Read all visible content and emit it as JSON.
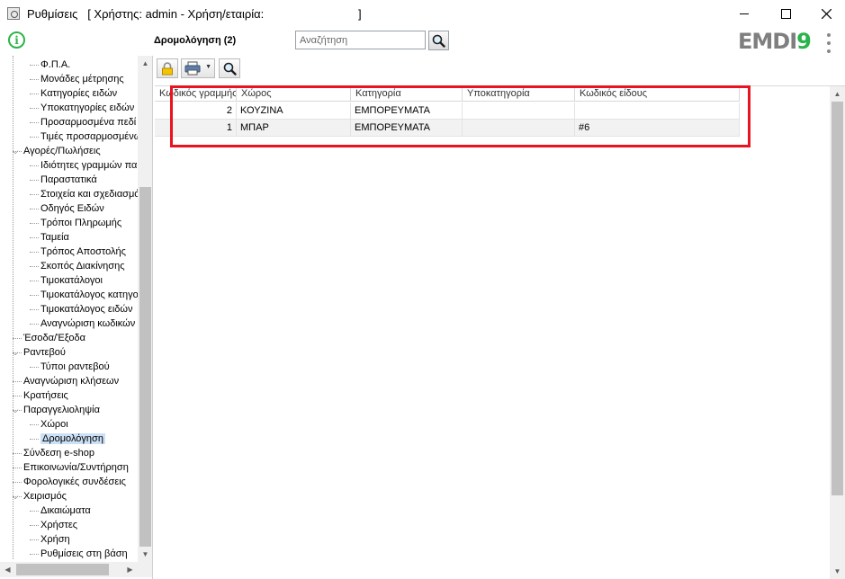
{
  "window": {
    "title": "Ρυθμίσεις   [ Χρήστης: admin - Χρήση/εταιρία:                             ]",
    "controls": {
      "minimize": "minimize",
      "maximize": "maximize",
      "close": "close"
    }
  },
  "header": {
    "page_title": "Δρομολόγηση (2)",
    "search_placeholder": "Αναζήτηση",
    "logo": {
      "part1": "EMDI",
      "part2": "9"
    }
  },
  "colors": {
    "brand_green": "#2db34a",
    "selection": "#cce0f5",
    "highlight": "#e8141f"
  },
  "tree": {
    "items": [
      {
        "label": "Φ.Π.Α.",
        "level": 2
      },
      {
        "label": "Μονάδες μέτρησης",
        "level": 2
      },
      {
        "label": "Κατηγορίες ειδών",
        "level": 2
      },
      {
        "label": "Υποκατηγορίες ειδών",
        "level": 2
      },
      {
        "label": "Προσαρμοσμένα πεδί",
        "level": 2
      },
      {
        "label": "Τιμές προσαρμοσμένω",
        "level": 2
      },
      {
        "label": "Αγορές/Πωλήσεις",
        "level": 1,
        "expanded": true
      },
      {
        "label": "Ιδιότητες γραμμών πα",
        "level": 2
      },
      {
        "label": "Παραστατικά",
        "level": 2
      },
      {
        "label": "Στοιχεία και σχεδιασμό",
        "level": 2
      },
      {
        "label": "Οδηγός Ειδών",
        "level": 2
      },
      {
        "label": "Τρόποι Πληρωμής",
        "level": 2
      },
      {
        "label": "Ταμεία",
        "level": 2
      },
      {
        "label": "Τρόπος Αποστολής",
        "level": 2
      },
      {
        "label": "Σκοπός Διακίνησης",
        "level": 2
      },
      {
        "label": "Τιμοκατάλογοι",
        "level": 2
      },
      {
        "label": "Τιμοκατάλογος κατηγο",
        "level": 2
      },
      {
        "label": "Τιμοκατάλογος ειδών",
        "level": 2
      },
      {
        "label": "Αναγνώριση κωδικών",
        "level": 2
      },
      {
        "label": "Έσοδα/Έξοδα",
        "level": 1
      },
      {
        "label": "Ραντεβού",
        "level": 1,
        "expanded": true
      },
      {
        "label": "Τύποι ραντεβού",
        "level": 2
      },
      {
        "label": "Αναγνώριση κλήσεων",
        "level": 1
      },
      {
        "label": "Κρατήσεις",
        "level": 1
      },
      {
        "label": "Παραγγελιοληψία",
        "level": 1,
        "expanded": true
      },
      {
        "label": "Χώροι",
        "level": 2
      },
      {
        "label": "Δρομολόγηση",
        "level": 2,
        "selected": true
      },
      {
        "label": "Σύνδεση e-shop",
        "level": 1
      },
      {
        "label": "Επικοινωνία/Συντήρηση",
        "level": 1
      },
      {
        "label": "Φορολογικές συνδέσεις",
        "level": 1
      },
      {
        "label": "Χειρισμός",
        "level": 1,
        "expanded": true
      },
      {
        "label": "Δικαιώματα",
        "level": 2
      },
      {
        "label": "Χρήστες",
        "level": 2
      },
      {
        "label": "Χρήση",
        "level": 2
      },
      {
        "label": "Ρυθμίσεις στη βάση",
        "level": 2
      }
    ]
  },
  "toolbar": {
    "lock_icon": "lock-icon",
    "print_icon": "printer-icon",
    "search_icon": "magnifier-icon"
  },
  "grid": {
    "columns": [
      "Κωδικός γραμμής",
      "Χώρος",
      "Κατηγορία",
      "Υποκατηγορία",
      "Κωδικός είδους"
    ],
    "rows": [
      [
        "2",
        "ΚΟΥΖΙΝΑ",
        "ΕΜΠΟΡΕΥΜΑΤΑ",
        "",
        ""
      ],
      [
        "1",
        "ΜΠΑΡ",
        "ΕΜΠΟΡΕΥΜΑΤΑ",
        "",
        "#6"
      ]
    ]
  }
}
